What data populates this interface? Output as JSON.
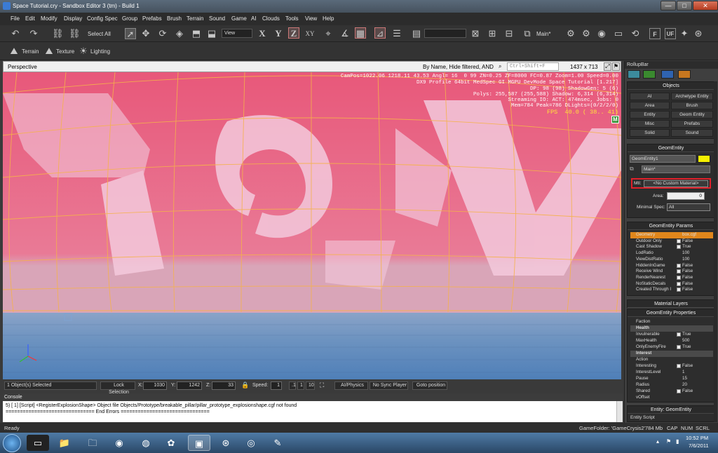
{
  "window": {
    "title": "Space Tutorial.cry - Sandbox Editor 3 (tm) - Build 1",
    "minimize": "—",
    "maximize": "□",
    "close": "✕"
  },
  "menu": [
    "File",
    "Edit",
    "Modify",
    "Display",
    "Config Spec",
    "Group",
    "Prefabs",
    "Brush",
    "Terrain",
    "Sound",
    "Game",
    "AI",
    "Clouds",
    "Tools",
    "View",
    "Help"
  ],
  "toolbar": {
    "select_all": "Select All",
    "view": "View",
    "axis_x": "X",
    "axis_y": "Y",
    "axis_z": "Z",
    "axis_xy": "XY",
    "layer": "Main*",
    "terrain": "Terrain",
    "texture": "Texture",
    "lighting": "Lighting"
  },
  "viewport": {
    "name": "Perspective",
    "filter": "By Name, Hide filtered, AND",
    "search_placeholder": "Ctrl+Shift+F",
    "resolution": "1437 x 713",
    "hud_lines": [
      "CamPos=1022.06 1218.11 43.53 Angl= 16  0 99 ZN=0.25 ZF=8000 FC=0.87 Zoom=1.00 Speed=0.00",
      "DX9 Profile 64bit MedSpec GI MGPU DevMode Space Tutorial [1.217]",
      "DP: 98 (98) ShadowGen: 5 (6)",
      "Polys: 255,587 (255,588) Shadow: 6,314 (6,314)",
      "Streaming IO: ACT: 474msec, Jobs: 0",
      "Mem=784 Peak=786 DLights=(0/2/2/0)"
    ],
    "fps": "FPS  40.0 ( 38.. 41)",
    "badge": "M"
  },
  "status_strip": {
    "selected": "1 Object(s) Selected",
    "lock_selection": "Lock Selection",
    "x_label": "X:",
    "x_value": "1030",
    "y_label": "Y:",
    "y_value": "1242",
    "z_label": "Z:",
    "z_value": "33",
    "speed_label": "Speed:",
    "speed_value": "1",
    "speed_opts": [
      ".1",
      "1",
      "10"
    ],
    "ai_physics": "AI/Physics",
    "no_sync": "No Sync Player",
    "goto": "Goto position"
  },
  "console": {
    "title": "Console",
    "line1": "5) [ 1]   [Script]    <RegisterExplosionShape> Object file Objects/Prototype/breakable_pillar/pillar_prototype_explosionshape.cgf not found",
    "line2": "=============================== End Errors ==============================="
  },
  "statusbar": {
    "left": "Ready",
    "folder": "GameFolder: 'GameCrysis2'",
    "mem": "784 Mb",
    "cap": "CAP",
    "num": "NUM",
    "scrl": "SCRL"
  },
  "rollup": {
    "title": "RollupBar",
    "objects_title": "Objects",
    "objects": [
      "AI",
      "Archetype Entity",
      "Area",
      "Brush",
      "Entity",
      "Geom Entity",
      "Misc",
      "Prefabs",
      "Solid",
      "Sound"
    ],
    "geom_title": "GeomEntity",
    "geom_name": "GeomEntity1",
    "layer": "Main*",
    "mtl_label": "Mtl:",
    "mtl_value": "<No Custom Material>",
    "area_label": "Area:",
    "area_value": "0",
    "minspec_label": "Minimal Spec:",
    "minspec_value": "All",
    "params_title": "GeomEntity Params",
    "params": [
      {
        "name": "Geometry",
        "value": "box.cgf"
      },
      {
        "name": "Outdoor Only",
        "value": "False"
      },
      {
        "name": "Cast Shadow",
        "value": "True"
      },
      {
        "name": "LodRatio",
        "value": "100"
      },
      {
        "name": "ViewDistRatio",
        "value": "100"
      },
      {
        "name": "HiddenInGame",
        "value": "False"
      },
      {
        "name": "Receive Wind",
        "value": "False"
      },
      {
        "name": "RenderNearest",
        "value": "False"
      },
      {
        "name": "NoStaticDecals",
        "value": "False"
      },
      {
        "name": "Created Through I",
        "value": "False"
      }
    ],
    "material_layers": "Material Layers",
    "props_title": "GeomEntity Properties",
    "props": [
      {
        "name": "Faction",
        "value": "",
        "group": false
      },
      {
        "name": "Health",
        "value": "",
        "group": true
      },
      {
        "name": "Invulnerable",
        "value": "True",
        "group": false
      },
      {
        "name": "MaxHealth",
        "value": "500",
        "group": false
      },
      {
        "name": "OnlyEnemyFire",
        "value": "True",
        "group": false
      },
      {
        "name": "Interest",
        "value": "",
        "group": true
      },
      {
        "name": "Action",
        "value": "",
        "group": false
      },
      {
        "name": "Interesting",
        "value": "False",
        "group": false
      },
      {
        "name": "InterestLevel",
        "value": "1",
        "group": false
      },
      {
        "name": "Pause",
        "value": "15",
        "group": false
      },
      {
        "name": "Radius",
        "value": "20",
        "group": false
      },
      {
        "name": "Shared",
        "value": "False",
        "group": false
      },
      {
        "name": "vOffset",
        "value": "",
        "group": false
      }
    ],
    "entity_title": "Entity: GeomEntity",
    "entity_script": "Entity Script"
  },
  "taskbar": {
    "time": "10:52 PM",
    "date": "7/6/2011"
  },
  "colors": {
    "viewport_sky": "#e8637e",
    "grid_line": "#f5b24a",
    "mtl_highlight": "#e0202a",
    "geom_color_swatch": "#f5f000",
    "selected_param": "#e0861c"
  }
}
